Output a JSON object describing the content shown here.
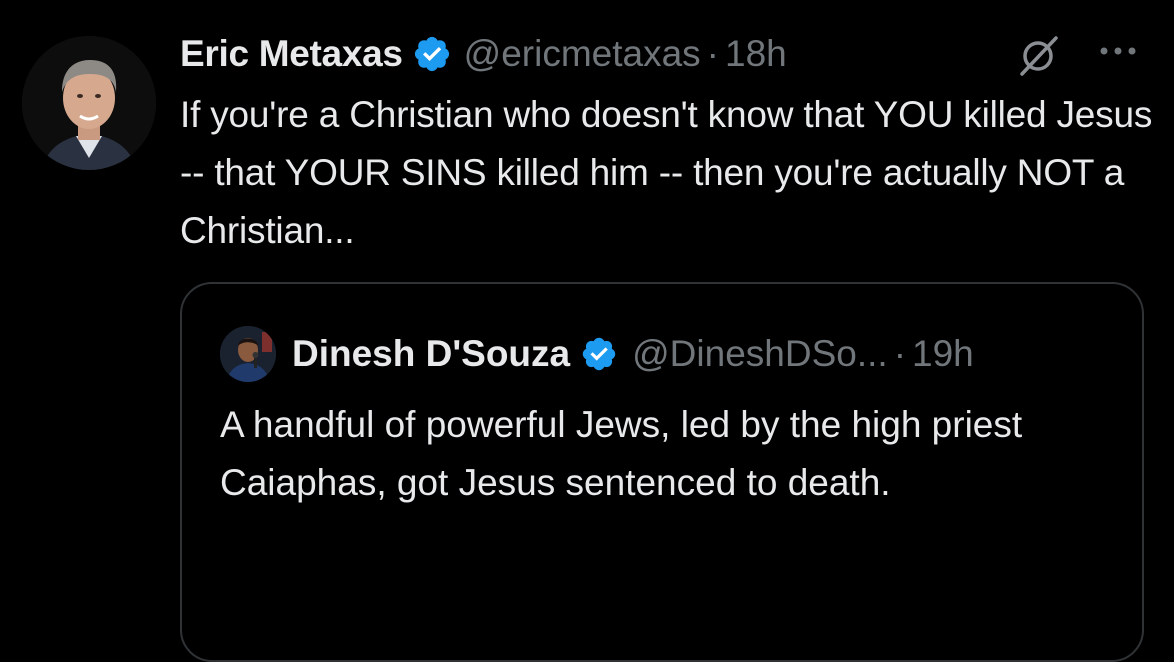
{
  "tweet": {
    "author": {
      "name": "Eric Metaxas",
      "handle": "@ericmetaxas",
      "verified": true
    },
    "separator": "·",
    "time": "18h",
    "text": "If you're a Christian who doesn't know that YOU killed Jesus -- that YOUR SINS killed him -- then you're actually NOT a Christian...",
    "icons": {
      "grok": "grok-icon",
      "more": "more-options-icon",
      "verified": "verified-badge-icon"
    }
  },
  "quoted_tweet": {
    "author": {
      "name": "Dinesh D'Souza",
      "handle": "@DineshDSo...",
      "verified": true
    },
    "separator": "·",
    "time": "19h",
    "text": "A handful of powerful Jews, led by the high priest Caiaphas, got Jesus sentenced to death."
  },
  "colors": {
    "background": "#000000",
    "text_primary": "#e7e9ea",
    "text_secondary": "#71767b",
    "verified_blue": "#1d9bf0",
    "border": "#2f3336"
  }
}
